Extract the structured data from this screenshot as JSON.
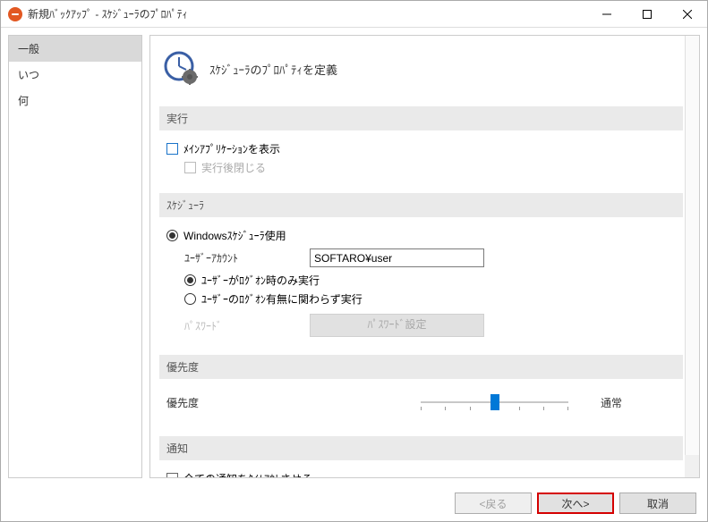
{
  "window": {
    "title": "新規ﾊﾞｯｸｱｯﾌﾟ - ｽｹｼﾞｭｰﾗのﾌﾟﾛﾊﾟﾃｨ"
  },
  "sidebar": {
    "items": [
      {
        "label": "一般",
        "selected": true
      },
      {
        "label": "いつ",
        "selected": false
      },
      {
        "label": "何",
        "selected": false
      }
    ]
  },
  "header": {
    "text": "ｽｹｼﾞｭｰﾗのﾌﾟﾛﾊﾟﾃｨを定義"
  },
  "sections": {
    "run": {
      "title": "実行",
      "show_main_app": {
        "label": "ﾒｲﾝｱﾌﾟﾘｹｰｼｮﾝを表示",
        "checked": false
      },
      "close_after_run": {
        "label": "実行後閉じる",
        "checked": false,
        "disabled": true
      }
    },
    "scheduler": {
      "title": "ｽｹｼﾞｭｰﾗ",
      "use_windows": {
        "label": "Windowsｽｹｼﾞｭｰﾗ使用",
        "checked": true
      },
      "user_account": {
        "label": "ﾕｰｻﾞｰｱｶｳﾝﾄ",
        "value": "SOFTARO¥user"
      },
      "run_when_logged_on": {
        "label": "ﾕｰｻﾞｰがﾛｸﾞｵﾝ時のみ実行",
        "checked": true
      },
      "run_regardless": {
        "label": "ﾕｰｻﾞｰのﾛｸﾞｵﾝ有無に関わらず実行",
        "checked": false
      },
      "password": {
        "label": "ﾊﾟｽﾜｰﾄﾞ",
        "button": "ﾊﾟｽﾜｰﾄﾞ設定"
      }
    },
    "priority": {
      "title": "優先度",
      "label": "優先度",
      "value_label": "通常"
    },
    "notification": {
      "title": "通知",
      "timeout_all": {
        "label": "全ての通知をﾀｲﾑｱｳﾄさせる",
        "checked": false
      }
    }
  },
  "footer": {
    "back": "<戻る",
    "next": "次へ>",
    "cancel": "取消"
  }
}
